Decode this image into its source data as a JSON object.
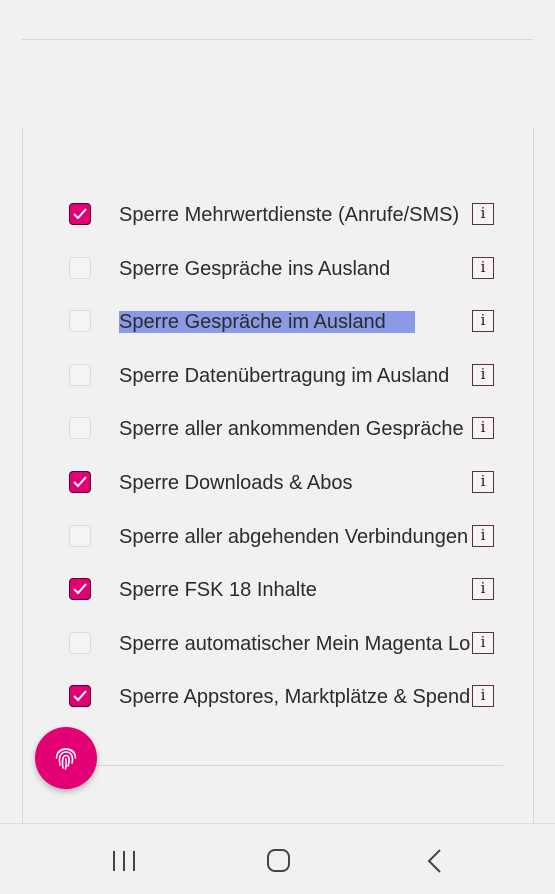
{
  "settings": {
    "items": [
      {
        "label": "Sperre Mehrwertdienste (Anrufe/SMS)",
        "checked": true,
        "info": "i"
      },
      {
        "label": "Sperre Gespräche ins Ausland",
        "checked": false,
        "info": "i"
      },
      {
        "label": "Sperre Gespräche im Ausland",
        "checked": false,
        "info": "i",
        "selected": true
      },
      {
        "label": "Sperre Datenübertragung im Ausland",
        "checked": false,
        "info": "i"
      },
      {
        "label": "Sperre aller ankommenden Gespräche",
        "checked": false,
        "info": "i"
      },
      {
        "label": "Sperre Downloads & Abos",
        "checked": true,
        "info": "i"
      },
      {
        "label": "Sperre aller abgehenden Verbindungen",
        "checked": false,
        "info": "i"
      },
      {
        "label": "Sperre FSK 18 Inhalte",
        "checked": true,
        "info": "i"
      },
      {
        "label": "Sperre automatischer Mein Magenta Login",
        "checked": false,
        "info": "i"
      },
      {
        "label": "Sperre Appstores, Marktplätze & Spenden",
        "checked": true,
        "info": "i"
      }
    ]
  },
  "fab": {
    "icon": "fingerprint-icon"
  },
  "navbar": {
    "recents": "recents-icon",
    "home": "home-icon",
    "back": "back-icon"
  },
  "colors": {
    "accent": "#e20074",
    "selection": "#8b9ae6"
  }
}
